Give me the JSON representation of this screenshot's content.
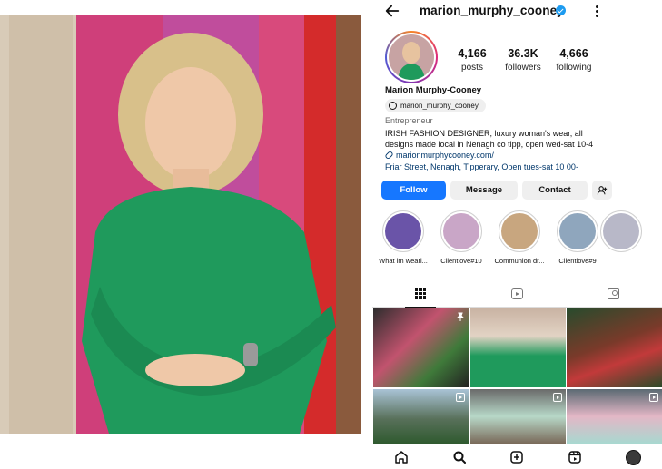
{
  "profile": {
    "username": "marion_murphy_cooney",
    "display_name": "Marion Murphy-Cooney",
    "threads_handle": "marion_murphy_cooney",
    "category": "Entrepreneur",
    "bio": "IRISH FASHION DESIGNER, luxury woman's wear, all designs made local in Nenagh co tipp, open wed-sat 10-4",
    "link": "marionmurphycooney.com/",
    "address": "Friar Street, Nenagh, Tipperary, Open tues-sat 10 00-"
  },
  "stats": [
    {
      "value": "4,166",
      "label": "posts"
    },
    {
      "value": "36.3K",
      "label": "followers"
    },
    {
      "value": "4,666",
      "label": "following"
    }
  ],
  "actions": {
    "follow": "Follow",
    "message": "Message",
    "contact": "Contact"
  },
  "highlights": [
    {
      "label": "What im weari...",
      "color": "#6a54a8"
    },
    {
      "label": "Clientlove#10",
      "color": "#c9a6c7"
    },
    {
      "label": "Communion dr...",
      "color": "#c8a67f"
    },
    {
      "label": "Clientlove#9",
      "color": "#8fa6bd"
    }
  ],
  "icons": {
    "back": "arrow-left-icon",
    "verified": "verified-badge-icon",
    "more": "kebab-menu-icon",
    "threads": "threads-icon",
    "link": "link-icon",
    "add_user": "add-user-icon",
    "grid": "grid-icon",
    "reels": "reels-icon",
    "tagged": "tagged-icon",
    "home": "home-icon",
    "search": "search-icon",
    "create": "plus-square-icon",
    "reels_nav": "reels-icon",
    "profile": "profile-avatar-icon"
  },
  "colors": {
    "accent": "#1677ff",
    "link": "#00376b",
    "dress": "#1f9a5c"
  }
}
